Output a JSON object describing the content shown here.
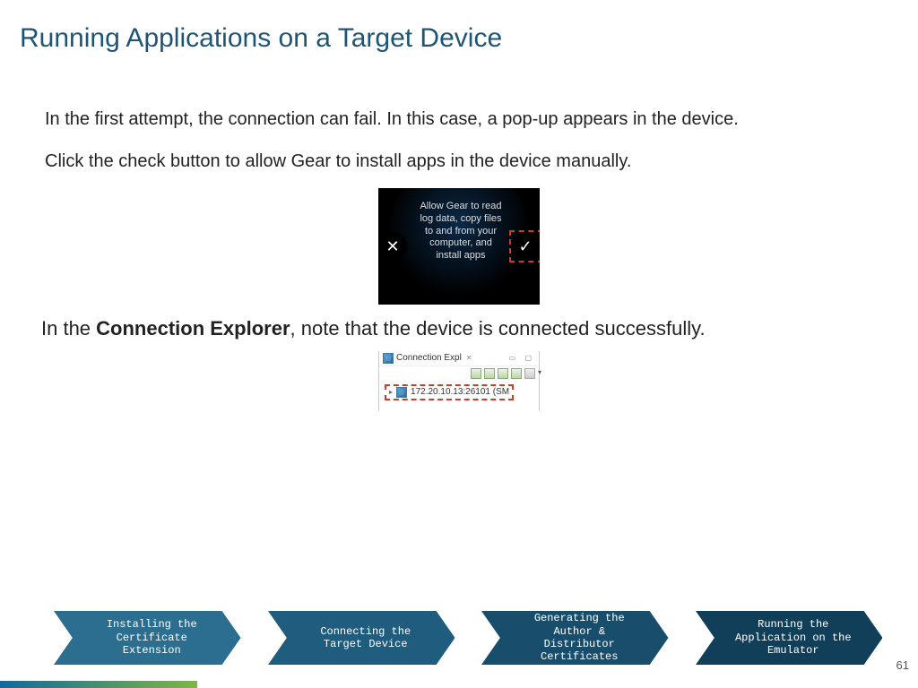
{
  "title": "Running Applications on a Target Device",
  "para1": "In the first attempt, the connection can fail. In this case, a pop-up appears in the device.",
  "para2": "Click the check button to allow Gear to install apps in the device manually.",
  "para3_prefix": "In the ",
  "para3_bold": "Connection Explorer",
  "para3_suffix": ", note that the device is connected successfully.",
  "watch": {
    "message": "Allow Gear to read log data, copy files to and from your computer, and install apps",
    "x": "✕",
    "check": "✓"
  },
  "connection_explorer": {
    "tab_label": "Connection Expl",
    "close_glyph": "✕",
    "device_label": "172.20.10.13:26101 (SM"
  },
  "nav": [
    {
      "label": "Installing the\nCertificate\nExtension",
      "fill": "#2c6e8f"
    },
    {
      "label": "Connecting the\nTarget Device",
      "fill": "#1f5c7d"
    },
    {
      "label": "Generating the\nAuthor &\nDistributor\nCertificates",
      "fill": "#184e6c"
    },
    {
      "label": "Running the\nApplication on the\nEmulator",
      "fill": "#113f59"
    }
  ],
  "page_number": "61"
}
